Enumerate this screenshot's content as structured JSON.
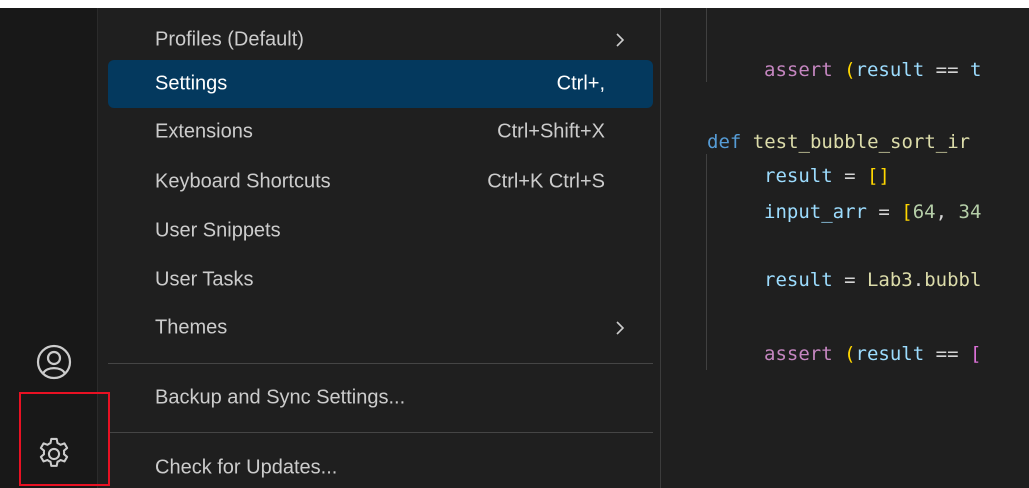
{
  "menu": {
    "items": [
      {
        "label": "Profiles (Default)",
        "shortcut": "",
        "submenu": true,
        "selected": false
      },
      {
        "label": "Settings",
        "shortcut": "Ctrl+,",
        "submenu": false,
        "selected": true
      },
      {
        "label": "Extensions",
        "shortcut": "Ctrl+Shift+X",
        "submenu": false,
        "selected": false
      },
      {
        "label": "Keyboard Shortcuts",
        "shortcut": "Ctrl+K Ctrl+S",
        "submenu": false,
        "selected": false
      },
      {
        "label": "User Snippets",
        "shortcut": "",
        "submenu": false,
        "selected": false
      },
      {
        "label": "User Tasks",
        "shortcut": "",
        "submenu": false,
        "selected": false
      },
      {
        "label": "Themes",
        "shortcut": "",
        "submenu": true,
        "selected": false
      },
      {
        "label": "Backup and Sync Settings...",
        "shortcut": "",
        "submenu": false,
        "selected": false
      },
      {
        "label": "Check for Updates...",
        "shortcut": "",
        "submenu": false,
        "selected": false
      }
    ]
  },
  "activity_bar": {
    "accounts_icon": "account-icon",
    "manage_icon": "gear-icon"
  },
  "editor": {
    "line1": {
      "kw": "assert",
      "sp": " ",
      "p": "(",
      "v": "result",
      "op": " == ",
      "rest": "t"
    },
    "line2": {
      "kw": "def",
      "sp": " ",
      "fn": "test_bubble_sort_ir"
    },
    "line3": {
      "v": "result",
      "op": " = ",
      "p": "[]"
    },
    "line4": {
      "v": "input_arr",
      "op": " = ",
      "p": "[",
      "n1": "64",
      "c": ", ",
      "n2": "34"
    },
    "line5": {
      "v": "result",
      "op": " = ",
      "mod": "Lab3",
      "dot": ".",
      "fn": "bubbl"
    },
    "line6": {
      "kw": "assert",
      "sp": " ",
      "p": "(",
      "v": "result",
      "op": " == ",
      "p2": "["
    }
  },
  "colors": {
    "selected_bg": "#04395e",
    "highlight_border": "#e81123",
    "menu_bg": "#1f1f1f"
  }
}
